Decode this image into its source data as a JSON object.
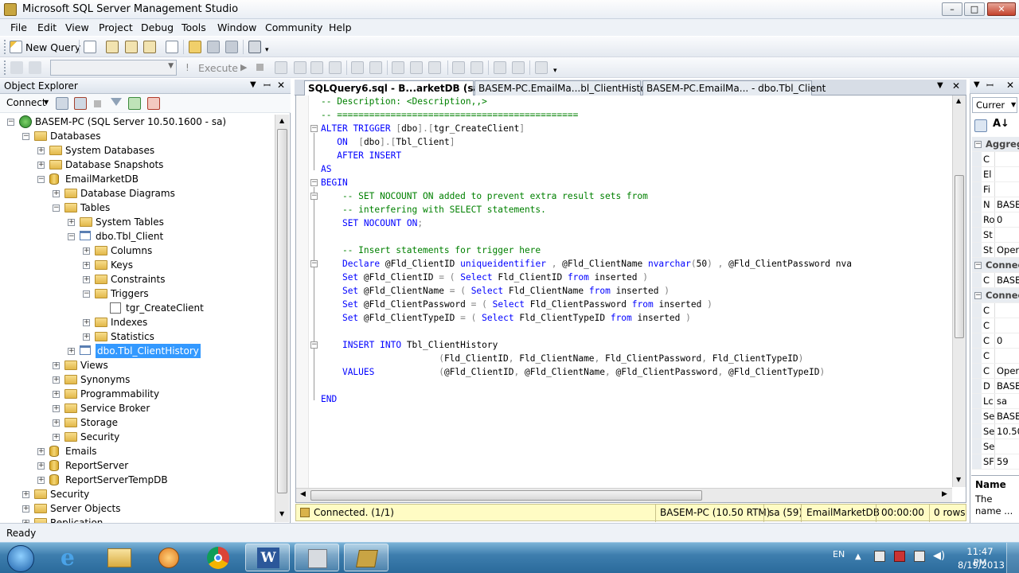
{
  "window": {
    "title": "Microsoft SQL Server Management Studio",
    "minimize": "–",
    "maximize": "□",
    "close": "✕"
  },
  "menu": [
    "File",
    "Edit",
    "View",
    "Project",
    "Debug",
    "Tools",
    "Window",
    "Community",
    "Help"
  ],
  "toolbar": {
    "new_query": "New Query",
    "execute": "Execute",
    "icons": [
      "new-file-icon",
      "database-engine-query-icon",
      "analysis-query-icon",
      "mdx-query-icon",
      "dmx-query-icon",
      "xmla-query-icon",
      "open-file-icon",
      "save-icon",
      "save-all-icon",
      "activity-monitor-icon"
    ]
  },
  "object_explorer": {
    "title": "Object Explorer",
    "connect": "Connect",
    "tree": [
      {
        "label": "BASEM-PC (SQL Server 10.50.1600 - sa)",
        "type": "server",
        "level": 0,
        "state": "-"
      },
      {
        "label": "Databases",
        "type": "folder",
        "level": 1,
        "state": "-"
      },
      {
        "label": "System Databases",
        "type": "folder",
        "level": 2,
        "state": "+"
      },
      {
        "label": "Database Snapshots",
        "type": "folder",
        "level": 2,
        "state": "+"
      },
      {
        "label": "EmailMarketDB",
        "type": "db",
        "level": 2,
        "state": "-"
      },
      {
        "label": "Database Diagrams",
        "type": "folder",
        "level": 3,
        "state": "+"
      },
      {
        "label": "Tables",
        "type": "folder",
        "level": 3,
        "state": "-"
      },
      {
        "label": "System Tables",
        "type": "folder",
        "level": 4,
        "state": "+"
      },
      {
        "label": "dbo.Tbl_Client",
        "type": "table",
        "level": 4,
        "state": "-"
      },
      {
        "label": "Columns",
        "type": "folder",
        "level": 5,
        "state": "+"
      },
      {
        "label": "Keys",
        "type": "folder",
        "level": 5,
        "state": "+"
      },
      {
        "label": "Constraints",
        "type": "folder",
        "level": 5,
        "state": "+"
      },
      {
        "label": "Triggers",
        "type": "folder",
        "level": 5,
        "state": "-"
      },
      {
        "label": "tgr_CreateClient",
        "type": "trigger",
        "level": 6,
        "state": ""
      },
      {
        "label": "Indexes",
        "type": "folder",
        "level": 5,
        "state": "+"
      },
      {
        "label": "Statistics",
        "type": "folder",
        "level": 5,
        "state": "+"
      },
      {
        "label": "dbo.Tbl_ClientHistory",
        "type": "table",
        "level": 4,
        "state": "+",
        "selected": true
      },
      {
        "label": "Views",
        "type": "folder",
        "level": 3,
        "state": "+"
      },
      {
        "label": "Synonyms",
        "type": "folder",
        "level": 3,
        "state": "+"
      },
      {
        "label": "Programmability",
        "type": "folder",
        "level": 3,
        "state": "+"
      },
      {
        "label": "Service Broker",
        "type": "folder",
        "level": 3,
        "state": "+"
      },
      {
        "label": "Storage",
        "type": "folder",
        "level": 3,
        "state": "+"
      },
      {
        "label": "Security",
        "type": "folder",
        "level": 3,
        "state": "+"
      },
      {
        "label": "Emails",
        "type": "db",
        "level": 2,
        "state": "+"
      },
      {
        "label": "ReportServer",
        "type": "db",
        "level": 2,
        "state": "+"
      },
      {
        "label": "ReportServerTempDB",
        "type": "db",
        "level": 2,
        "state": "+"
      },
      {
        "label": "Security",
        "type": "folder",
        "level": 1,
        "state": "+"
      },
      {
        "label": "Server Objects",
        "type": "folder",
        "level": 1,
        "state": "+"
      },
      {
        "label": "Replication",
        "type": "folder",
        "level": 1,
        "state": "+"
      }
    ]
  },
  "editor": {
    "tabs": [
      {
        "label": "SQLQuery6.sql - B...arketDB (sa (59))",
        "active": true
      },
      {
        "label": "BASEM-PC.EmailMa...bl_ClientHistory",
        "active": false
      },
      {
        "label": "BASEM-PC.EmailMa... - dbo.Tbl_Client",
        "active": false
      }
    ],
    "lines": [
      "-- Description: <Description,,>",
      "-- =============================================",
      "ALTER TRIGGER [dbo].[tgr_CreateClient]",
      "   ON  [dbo].[Tbl_Client]",
      "   AFTER INSERT",
      "AS",
      "BEGIN",
      "    -- SET NOCOUNT ON added to prevent extra result sets from",
      "    -- interfering with SELECT statements.",
      "    SET NOCOUNT ON;",
      "",
      "    -- Insert statements for trigger here",
      "    Declare @Fld_ClientID uniqueidentifier , @Fld_ClientName nvarchar(50) , @Fld_ClientPassword nva",
      "    Set @Fld_ClientID = ( Select Fld_ClientID from inserted )",
      "    Set @Fld_ClientName = ( Select Fld_ClientName from inserted )",
      "    Set @Fld_ClientPassword = ( Select Fld_ClientPassword from inserted )",
      "    Set @Fld_ClientTypeID = ( Select Fld_ClientTypeID from inserted )",
      "",
      "    INSERT INTO Tbl_ClientHistory",
      "                      (Fld_ClientID, Fld_ClientName, Fld_ClientPassword, Fld_ClientTypeID)",
      "    VALUES            (@Fld_ClientID, @Fld_ClientName, @Fld_ClientPassword, @Fld_ClientTypeID)",
      "",
      "END"
    ],
    "status": {
      "connected": "Connected. (1/1)",
      "server": "BASEM-PC (10.50 RTM)",
      "user": "sa (59)",
      "database": "EmailMarketDB",
      "time": "00:00:00",
      "rows": "0 rows"
    }
  },
  "properties": {
    "combo": "Currer",
    "rows": [
      {
        "type": "section",
        "label": "Aggreg"
      },
      {
        "type": "row",
        "label": "C",
        "value": ""
      },
      {
        "type": "row",
        "label": "El",
        "value": ""
      },
      {
        "type": "row",
        "label": "Fi",
        "value": ""
      },
      {
        "type": "row",
        "label": "N",
        "value": "BASE"
      },
      {
        "type": "row",
        "label": "Ro",
        "value": "0"
      },
      {
        "type": "row",
        "label": "St",
        "value": ""
      },
      {
        "type": "row",
        "label": "St",
        "value": "Oper"
      },
      {
        "type": "section",
        "label": "Connec"
      },
      {
        "type": "row",
        "label": "C",
        "value": "BASE"
      },
      {
        "type": "section",
        "label": "Connec"
      },
      {
        "type": "row",
        "label": "C",
        "value": ""
      },
      {
        "type": "row",
        "label": "C",
        "value": ""
      },
      {
        "type": "row",
        "label": "C",
        "value": "0"
      },
      {
        "type": "row",
        "label": "C",
        "value": ""
      },
      {
        "type": "row",
        "label": "C",
        "value": "Oper"
      },
      {
        "type": "row",
        "label": "D",
        "value": "BASE"
      },
      {
        "type": "row",
        "label": "Lc",
        "value": "sa"
      },
      {
        "type": "row",
        "label": "Se",
        "value": "BASE"
      },
      {
        "type": "row",
        "label": "Se",
        "value": "10.50"
      },
      {
        "type": "row",
        "label": "Se",
        "value": ""
      },
      {
        "type": "row",
        "label": "SF",
        "value": "59"
      }
    ],
    "desc_title": "Name",
    "desc_text": "The name ..."
  },
  "statusbar": {
    "text": "Ready"
  },
  "taskbar": {
    "apps": [
      "start-orb-icon",
      "internet-explorer-icon",
      "windows-explorer-icon",
      "media-player-icon",
      "chrome-icon",
      "word-icon",
      "sql-tools-icon",
      "ssms-icon"
    ],
    "lang": "EN",
    "time": "11:47 PM",
    "date": "8/19/2013"
  }
}
